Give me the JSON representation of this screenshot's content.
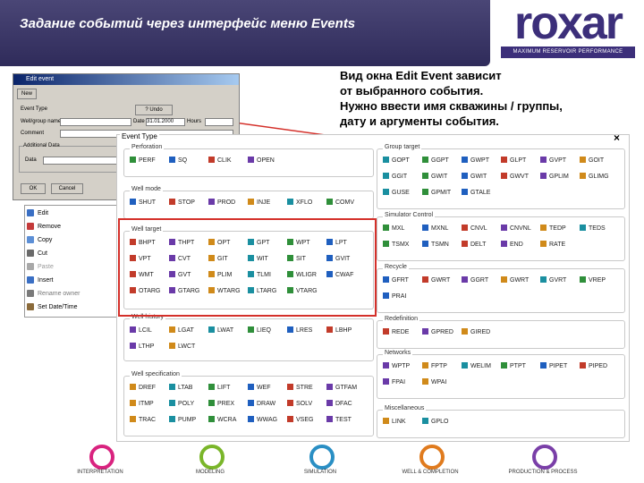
{
  "header": {
    "title": "Задание событий через интерфейс меню Events"
  },
  "logo": {
    "name": "roxar",
    "tagline": "MAXIMUM RESERVOIR PERFORMANCE"
  },
  "note": {
    "lines": [
      "Вид окна Edit Event зависит",
      "от выбранного события.",
      "Нужно ввести имя скважины / группы,",
      "дату и аргументы события."
    ]
  },
  "dialog": {
    "title": "Edit event",
    "tab": "New",
    "event_type_label": "Event Type",
    "event_type_btn": "? Undo",
    "well_group_label": "Well/group name",
    "date_label": "Date",
    "date_value": "31.01.2000",
    "hours_label": "Hours",
    "comment_label": "Comment",
    "additional_label": "Additional Data",
    "data_label": "Data",
    "ok": "OK",
    "cancel": "Cancel"
  },
  "menu": {
    "items": [
      {
        "label": "Edit",
        "color": "#3a6fc4"
      },
      {
        "label": "Remove",
        "color": "#c43a3a"
      },
      {
        "label": "Copy",
        "color": "#5c8fd6"
      },
      {
        "label": "Cut",
        "color": "#6a6a6a"
      },
      {
        "label": "Paste",
        "color": "#a8a8a8"
      },
      {
        "label": "Insert",
        "color": "#3a6fc4"
      },
      {
        "label": "Rename owner",
        "color": "#7a7a7a"
      },
      {
        "label": "Set Date/Time",
        "color": "#8a6a3a"
      }
    ]
  },
  "panel": {
    "label": "Event Type",
    "close": "×",
    "groups": [
      {
        "name": "Perforation",
        "items": [
          "PERF",
          "SQ",
          "CLIK",
          "OPEN"
        ]
      },
      {
        "name": "Well mode",
        "items": [
          "SHUT",
          "STOP",
          "PROD",
          "INJE",
          "XFLO",
          "COMV"
        ]
      },
      {
        "name": "Well target",
        "items": [
          "BHPT",
          "THPT",
          "OPT",
          "GPT",
          "WPT",
          "LPT",
          "VPT",
          "CVT",
          "GIT",
          "WIT",
          "SIT",
          "GVIT",
          "WMT",
          "GVT",
          "PLIM",
          "TLMI",
          "WLIGR",
          "CWAF",
          "OTARG",
          "GTARG",
          "WTARG",
          "LTARG",
          "VTARG"
        ]
      },
      {
        "name": "Well history",
        "items": [
          "LCIL",
          "LGAT",
          "LWAT",
          "LIEQ",
          "LRES",
          "LBHP",
          "LTHP",
          "LWCT"
        ]
      },
      {
        "name": "Well specification",
        "items": [
          "DREF",
          "LTAB",
          "LIFT",
          "WEF",
          "STRE",
          "GTFAM",
          "ITMP",
          "POLY",
          "PREX",
          "DRAW",
          "SOLV",
          "DFAC",
          "TRAC",
          "PUMP",
          "WCRA",
          "WWAG",
          "VSEG",
          "TEST"
        ]
      },
      {
        "name": "Group target",
        "items": [
          "GOPT",
          "GGPT",
          "GWPT",
          "GLPT",
          "GVPT",
          "GOIT",
          "GGIT",
          "GWIT",
          "GWIT",
          "GWVT",
          "GPLIM",
          "GLIMG",
          "GUSE",
          "GPMIT",
          "GTALE"
        ]
      },
      {
        "name": "Simulator Control",
        "items": [
          "MXL",
          "MXNL",
          "CNVL",
          "CNVNL",
          "TEDP",
          "TEDS",
          "TSMX",
          "TSMN",
          "DELT",
          "END",
          "RATE"
        ]
      },
      {
        "name": "Recycle",
        "items": [
          "GFRT",
          "GWRT",
          "GGRT",
          "GWRT",
          "GVRT",
          "VREP",
          "PRAI"
        ]
      },
      {
        "name": "Redefinition",
        "items": [
          "REDE",
          "GPRED",
          "GIRED"
        ]
      },
      {
        "name": "Networks",
        "items": [
          "WPTP",
          "FPTP",
          "WELIM",
          "PTPT",
          "PIPET",
          "PIPED",
          "FPAI",
          "WPAI"
        ]
      },
      {
        "name": "Miscellaneous",
        "items": [
          "LINK",
          "GPLO"
        ]
      }
    ]
  },
  "bottom": [
    {
      "label": "INTERPRETATION",
      "color": "#d9237f"
    },
    {
      "label": "MODELING",
      "color": "#7ab62a"
    },
    {
      "label": "SIMULATION",
      "color": "#2a8fc4"
    },
    {
      "label": "WELL & COMPLETION",
      "color": "#e07b1e"
    },
    {
      "label": "PRODUCTION & PROCESS",
      "color": "#7a3fa8"
    }
  ]
}
